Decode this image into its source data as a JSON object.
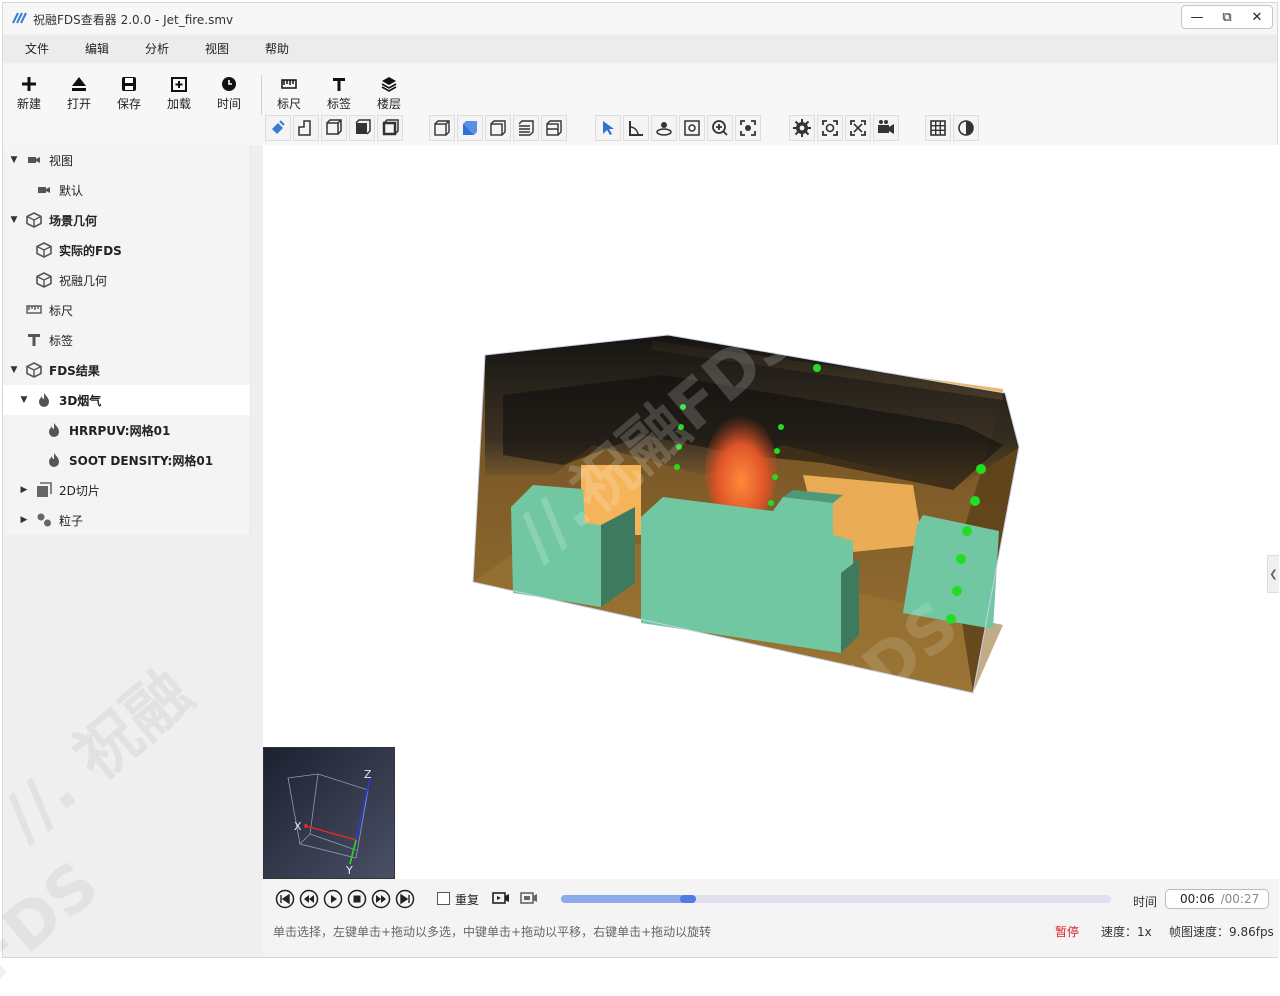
{
  "window": {
    "title": "祝融FDS查看器 2.0.0 - Jet_fire.smv",
    "minimize": "—",
    "restore": "⧉",
    "close": "✕"
  },
  "menu": [
    "文件",
    "编辑",
    "分析",
    "视图",
    "帮助"
  ],
  "toolbar": {
    "buttons": [
      {
        "label": "新建",
        "icon": "plus-icon"
      },
      {
        "label": "打开",
        "icon": "eject-icon"
      },
      {
        "label": "保存",
        "icon": "save-icon"
      },
      {
        "label": "加载",
        "icon": "load-icon"
      },
      {
        "label": "时间",
        "icon": "clock-icon"
      },
      {
        "label": "标尺",
        "icon": "ruler-icon"
      },
      {
        "label": "标签",
        "icon": "text-t-icon"
      },
      {
        "label": "楼层",
        "icon": "layers-icon"
      }
    ]
  },
  "tree": {
    "items": [
      {
        "label": "视图",
        "bold": false
      },
      {
        "label": "默认",
        "bold": false
      },
      {
        "label": "场景几何",
        "bold": true
      },
      {
        "label": "实际的FDS",
        "bold": true
      },
      {
        "label": "祝融几何",
        "bold": false
      },
      {
        "label": "标尺",
        "bold": false
      },
      {
        "label": "标签",
        "bold": false
      },
      {
        "label": "FDS结果",
        "bold": true
      },
      {
        "label": "3D烟气",
        "bold": true
      },
      {
        "label": "HRRPUV:网格01",
        "bold": true
      },
      {
        "label": "SOOT DENSITY:网格01",
        "bold": true
      },
      {
        "label": "2D切片",
        "bold": false
      },
      {
        "label": "粒子",
        "bold": false
      }
    ]
  },
  "axes": {
    "x": "X",
    "y": "Y",
    "z": "Z"
  },
  "playback": {
    "repeat_label": "重复",
    "progress": 0.23,
    "time_label": "时间",
    "current_time": "00:06",
    "total_time": "/00:27",
    "hint": "单击选择，左键单击+拖动以多选，中键单击+拖动以平移，右键单击+拖动以旋转",
    "state": "暂停",
    "speed": "速度：1x",
    "fps": "帧图速度：9.86fps"
  },
  "colors": {
    "accent": "#4f7ee3",
    "obstruction": "#72c7a3",
    "fire": "#e8642a",
    "smoke": "#1a1a1a",
    "wall": "#f5b45a",
    "sensor": "#22dd22"
  }
}
